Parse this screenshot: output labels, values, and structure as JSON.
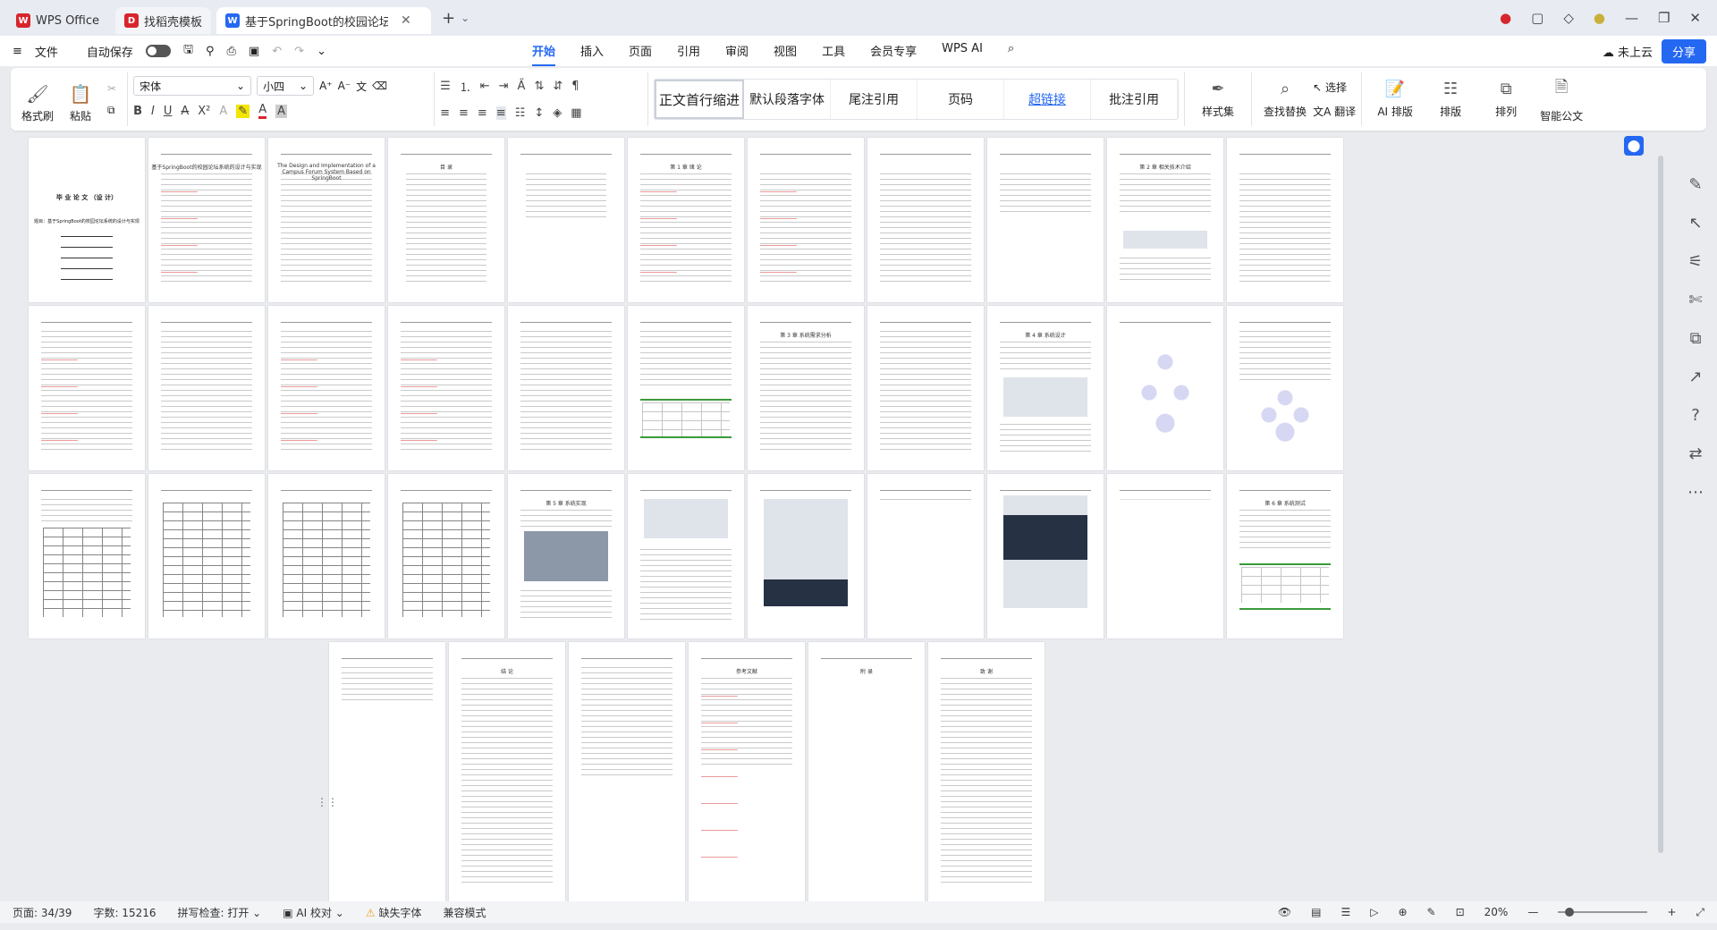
{
  "titlebar": {
    "tabs": [
      {
        "label": "WPS Office",
        "logo": "W",
        "color": "#d8252d"
      },
      {
        "label": "找稻壳模板",
        "logo": "D",
        "color": "#d8252d"
      },
      {
        "label": "基于SpringBoot的校园论坛",
        "logo": "W",
        "color": "#2468f2"
      }
    ],
    "new_tab": "+"
  },
  "menubar": {
    "file": "文件",
    "autosave": "自动保存",
    "menus": [
      "开始",
      "插入",
      "页面",
      "引用",
      "审阅",
      "视图",
      "工具",
      "会员专享",
      "WPS AI"
    ],
    "active_menu": "开始",
    "cloud": "未上云",
    "share": "分享"
  },
  "ribbon": {
    "format_painter": "格式刷",
    "paste": "粘贴",
    "font_name": "宋体",
    "font_size": "小四",
    "styles": [
      "正文首行缩进",
      "默认段落字体",
      "尾注引用",
      "页码",
      "超链接",
      "批注引用"
    ],
    "style_set": "样式集",
    "find_replace": "查找替换",
    "select": "选择",
    "translate": "翻译",
    "ai_layout": "AI 排版",
    "layout": "排版",
    "arrange": "排列",
    "smart_doc": "智能公文"
  },
  "pages": {
    "cover_title": "毕 业 论 文 （设 计）",
    "cover_subtitle": "题目：基于SpringBoot的校园论坛系统的设计与实现",
    "page2_title": "基于SpringBoot的校园论坛系统的设计与实现",
    "page3_title": "The Design and Implementation of a Campus Forum System Based on SpringBoot",
    "toc_title": "目 录",
    "ch1_title": "第 1 章  绪 论",
    "ch2_title": "第 2 章  相关技术介绍",
    "ch3_title": "第 3 章  系统需求分析",
    "ch4_title": "第 4 章  系统设计",
    "ch5_title": "第 5 章  系统实现",
    "ch6_title": "第 6 章  系统测试",
    "conclusion": "结 论",
    "references": "参考文献",
    "appendix": "附 录",
    "thanks": "致 谢"
  },
  "status": {
    "page": "页面: 34/39",
    "words": "字数: 15216",
    "spell": "拼写检查: 打开",
    "ai_check": "AI 校对",
    "missing_font": "缺失字体",
    "compat": "兼容模式",
    "zoom": "20%"
  },
  "colors": {
    "accent": "#2468f2",
    "wps_red": "#d8252d"
  }
}
